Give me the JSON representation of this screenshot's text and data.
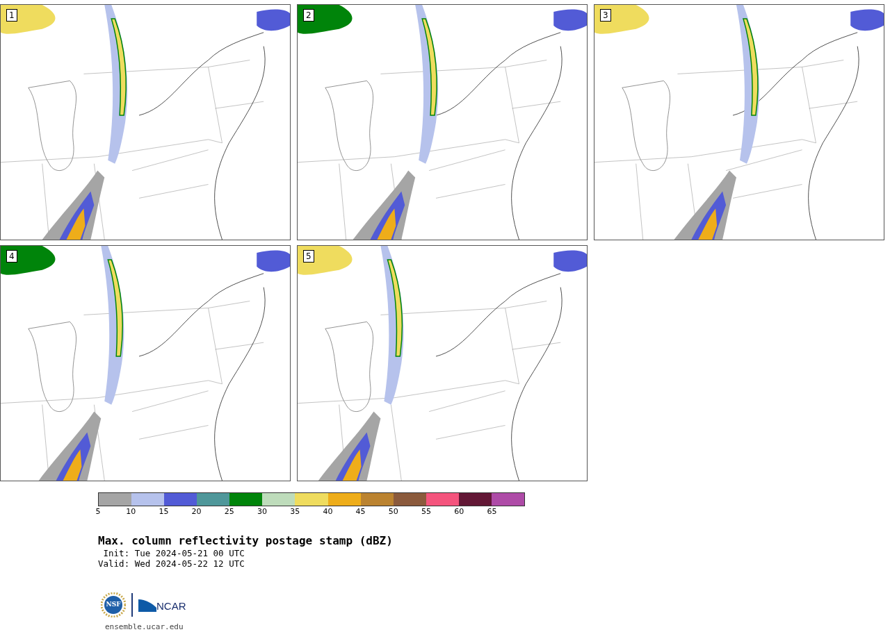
{
  "panels": [
    {
      "label": "1"
    },
    {
      "label": "2"
    },
    {
      "label": "3"
    },
    {
      "label": "4"
    },
    {
      "label": "5"
    }
  ],
  "colorbar": {
    "segments": [
      {
        "color": "#a5a5a5"
      },
      {
        "color": "#b6c2ec"
      },
      {
        "color": "#525bd6"
      },
      {
        "color": "#4f979a"
      },
      {
        "color": "#00840a"
      },
      {
        "color": "#bedcbb"
      },
      {
        "color": "#efdc5e"
      },
      {
        "color": "#eead1a"
      },
      {
        "color": "#bb8330"
      },
      {
        "color": "#8b5a3c"
      },
      {
        "color": "#f4547d"
      },
      {
        "color": "#621735"
      },
      {
        "color": "#ae4ba7"
      }
    ],
    "ticks": [
      "5",
      "10",
      "15",
      "20",
      "25",
      "30",
      "35",
      "40",
      "45",
      "50",
      "55",
      "60",
      "65"
    ]
  },
  "title": "Max. column reflectivity postage stamp (dBZ)",
  "init": " Init: Tue 2024-05-21 00 UTC",
  "valid": "Valid: Wed 2024-05-22 12 UTC",
  "logos": {
    "nsf": "NSF",
    "ncar": "NCAR"
  },
  "url": "ensemble.ucar.edu"
}
